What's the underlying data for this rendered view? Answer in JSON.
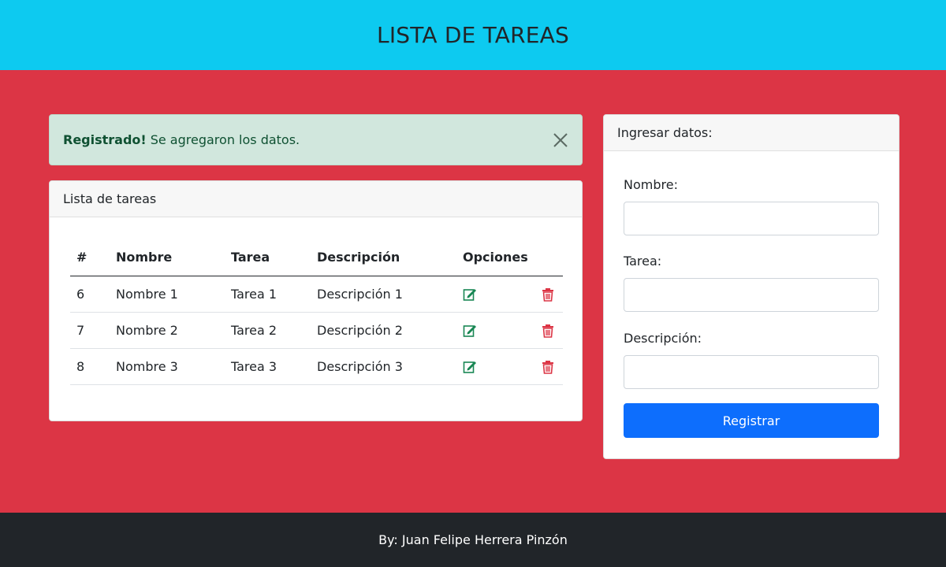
{
  "header": {
    "title": "LISTA DE TAREAS"
  },
  "alert": {
    "strong": "Registrado!",
    "message": "Se agregaron los datos.",
    "close_icon": "close-icon"
  },
  "tasks_card": {
    "title": "Lista de tareas",
    "columns": [
      "#",
      "Nombre",
      "Tarea",
      "Descripción",
      "Opciones"
    ],
    "rows": [
      {
        "id": "6",
        "nombre": "Nombre 1",
        "tarea": "Tarea 1",
        "descripcion": "Descripción 1"
      },
      {
        "id": "7",
        "nombre": "Nombre 2",
        "tarea": "Tarea 2",
        "descripcion": "Descripción 2"
      },
      {
        "id": "8",
        "nombre": "Nombre 3",
        "tarea": "Tarea 3",
        "descripcion": "Descripción 3"
      }
    ],
    "edit_icon": "edit-icon",
    "delete_icon": "trash-icon"
  },
  "form_card": {
    "title": "Ingresar datos:",
    "nombre_label": "Nombre:",
    "nombre_value": "",
    "tarea_label": "Tarea:",
    "tarea_value": "",
    "descripcion_label": "Descripción:",
    "descripcion_value": "",
    "submit_label": "Registrar"
  },
  "footer": {
    "text": "By: Juan Felipe Herrera Pinzón"
  },
  "colors": {
    "header_bg": "#0dcaf0",
    "page_bg": "#dc3545",
    "footer_bg": "#212529",
    "alert_bg": "#d1e7dd",
    "alert_text": "#0f5132",
    "primary": "#0d6efd",
    "edit_icon": "#198754",
    "delete_icon": "#dc3545"
  }
}
